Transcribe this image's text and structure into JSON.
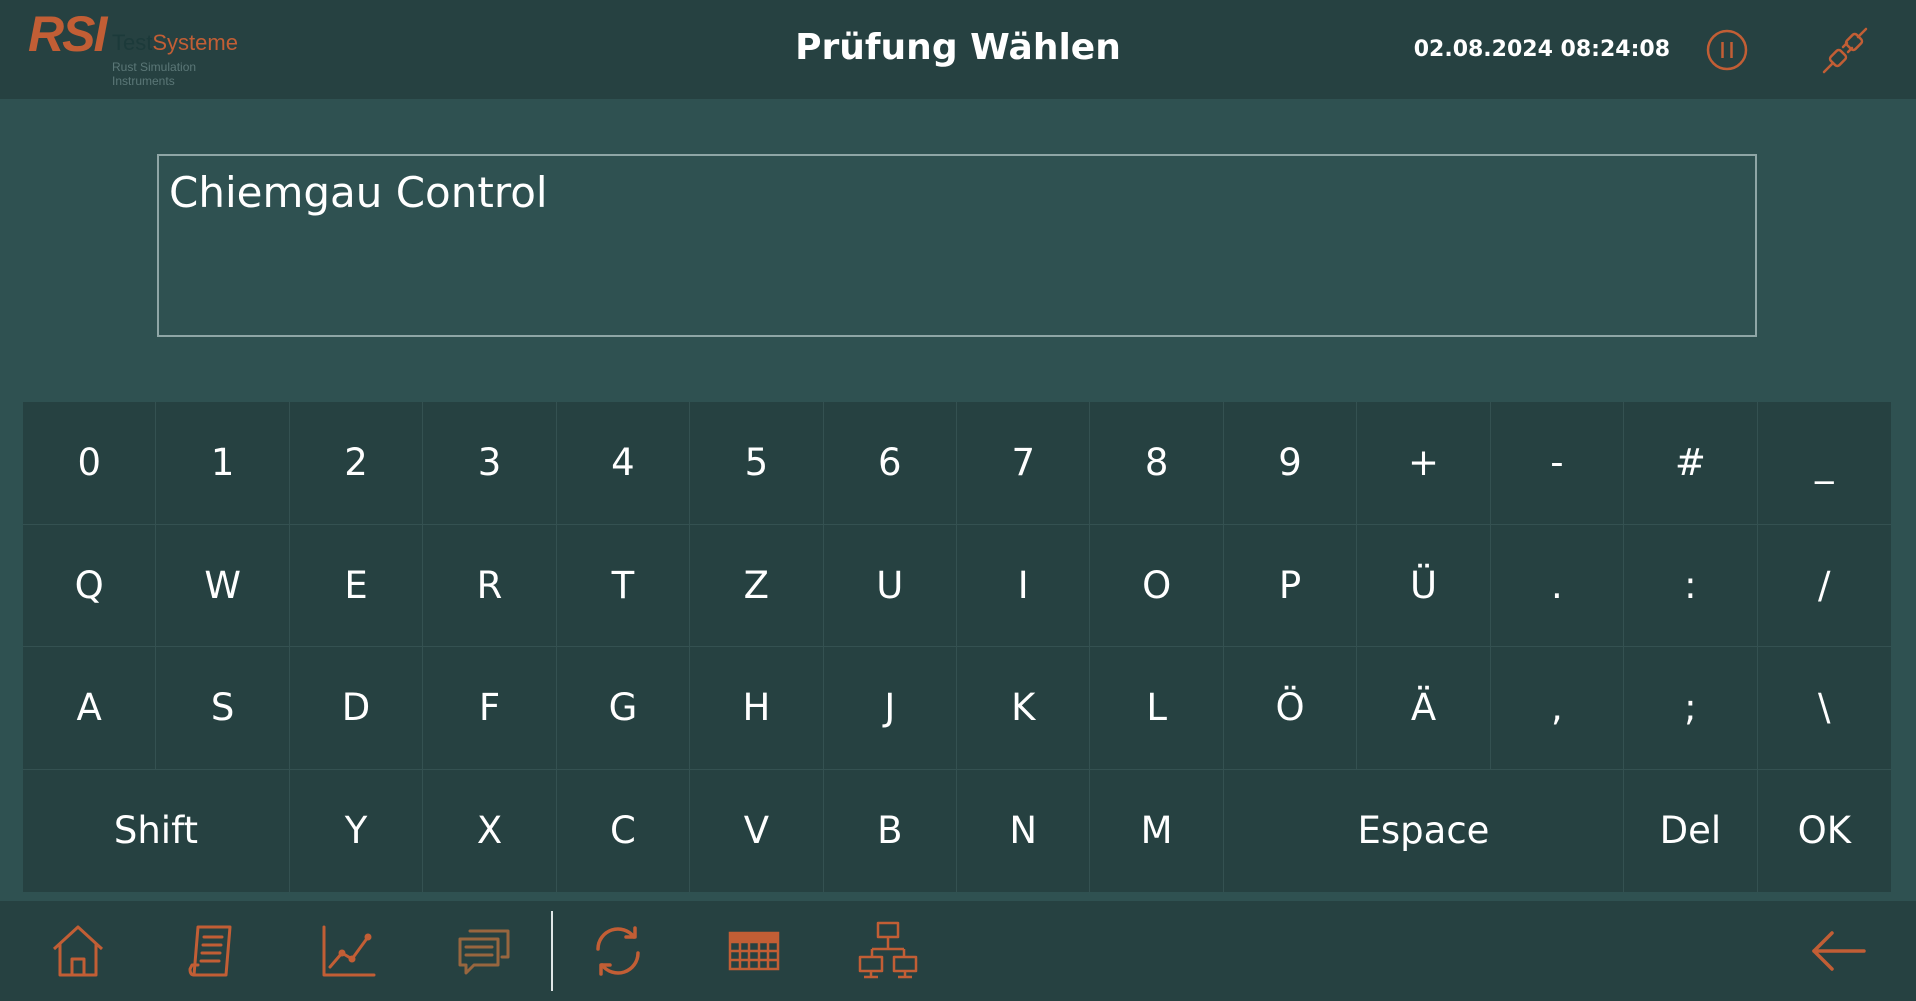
{
  "header": {
    "logo_mark": "RSI",
    "logo_name_a": "Test",
    "logo_name_b": "Systeme",
    "logo_tagline": "Rust Simulation Instruments",
    "title": "Prüfung Wählen",
    "datetime": "02.08.2024 08:24:08",
    "pause_icon": "pause-circle-icon",
    "connection_icon": "plug-disconnected-icon"
  },
  "input": {
    "value": "Chiemgau Control"
  },
  "keyboard": {
    "rows": [
      [
        {
          "label": "0"
        },
        {
          "label": "1"
        },
        {
          "label": "2"
        },
        {
          "label": "3"
        },
        {
          "label": "4"
        },
        {
          "label": "5"
        },
        {
          "label": "6"
        },
        {
          "label": "7"
        },
        {
          "label": "8"
        },
        {
          "label": "9"
        },
        {
          "label": "+"
        },
        {
          "label": "-"
        },
        {
          "label": "#"
        },
        {
          "label": "_"
        }
      ],
      [
        {
          "label": "Q"
        },
        {
          "label": "W"
        },
        {
          "label": "E"
        },
        {
          "label": "R"
        },
        {
          "label": "T"
        },
        {
          "label": "Z"
        },
        {
          "label": "U"
        },
        {
          "label": "I"
        },
        {
          "label": "O"
        },
        {
          "label": "P"
        },
        {
          "label": "Ü"
        },
        {
          "label": "."
        },
        {
          "label": ":"
        },
        {
          "label": "/"
        }
      ],
      [
        {
          "label": "A"
        },
        {
          "label": "S"
        },
        {
          "label": "D"
        },
        {
          "label": "F"
        },
        {
          "label": "G"
        },
        {
          "label": "H"
        },
        {
          "label": "J"
        },
        {
          "label": "K"
        },
        {
          "label": "L"
        },
        {
          "label": "Ö"
        },
        {
          "label": "Ä"
        },
        {
          "label": ","
        },
        {
          "label": ";"
        },
        {
          "label": "\\"
        }
      ],
      [
        {
          "label": "Shift",
          "span": 2
        },
        {
          "label": "Y"
        },
        {
          "label": "X"
        },
        {
          "label": "C"
        },
        {
          "label": "V"
        },
        {
          "label": "B"
        },
        {
          "label": "N"
        },
        {
          "label": "M"
        },
        {
          "label": "Espace",
          "span": 3
        },
        {
          "label": "Del"
        },
        {
          "label": "OK"
        }
      ]
    ]
  },
  "footer": {
    "nav": [
      {
        "name": "home-icon"
      },
      {
        "name": "document-list-icon"
      },
      {
        "name": "line-chart-icon"
      },
      {
        "name": "messages-icon"
      },
      {
        "name": "refresh-icon"
      },
      {
        "name": "grid-icon"
      },
      {
        "name": "network-icon"
      }
    ],
    "back_icon": "arrow-left-icon"
  },
  "colors": {
    "accent": "#c25e35",
    "background": "#2f5151",
    "bar": "#264141",
    "key_divider": "#345151",
    "text": "#ffffff"
  }
}
